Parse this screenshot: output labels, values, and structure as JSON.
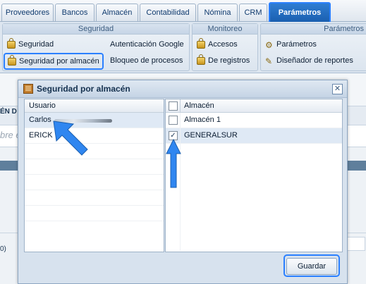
{
  "tabs": [
    {
      "label": "Proveedores",
      "active": false
    },
    {
      "label": "Bancos",
      "active": false
    },
    {
      "label": "Almacén",
      "active": false
    },
    {
      "label": "Contabilidad",
      "active": false
    },
    {
      "label": "Nómina",
      "active": false
    },
    {
      "label": "CRM",
      "active": false
    },
    {
      "label": "Parámetros",
      "active": true
    }
  ],
  "ribbon": {
    "seguridad": {
      "title": "Seguridad",
      "items": [
        "Seguridad",
        "Autenticación Google",
        "Seguridad por almacén",
        "Bloqueo de procesos"
      ]
    },
    "monitoreo": {
      "title": "Monitoreo",
      "items": [
        "Accesos",
        "De registros"
      ]
    },
    "parametros": {
      "title": "Parámetros",
      "items": [
        "Parámetros",
        "Diseñador de reportes"
      ]
    }
  },
  "background": {
    "label1": "ÉN D",
    "label2": "bre e",
    "label3": "0)"
  },
  "modal": {
    "title": "Seguridad por almacén",
    "users": {
      "header": "Usuario",
      "rows": [
        {
          "name": "Carlos",
          "selected": true
        },
        {
          "name": "ERICK",
          "selected": false
        }
      ]
    },
    "almacenes": {
      "header": "Almacén",
      "rows": [
        {
          "name": "Almacén 1",
          "checked": false
        },
        {
          "name": "GENERALSUR",
          "checked": true
        }
      ]
    },
    "save_label": "Guardar"
  },
  "colors": {
    "accent": "#2b80ff",
    "active_tab": "#1a5fb0",
    "arrow": "#2f86f0"
  }
}
